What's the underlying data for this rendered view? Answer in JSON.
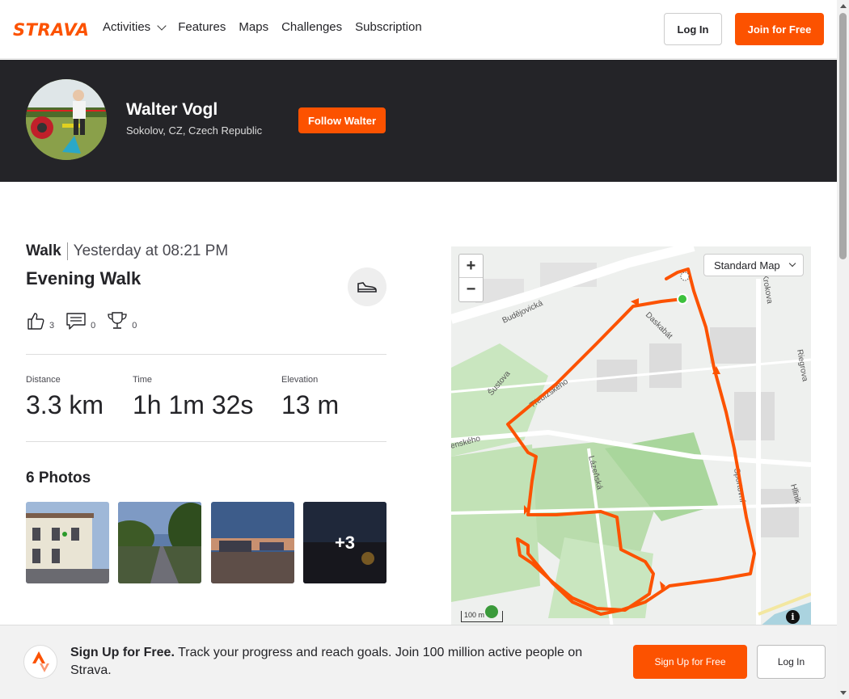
{
  "brand": {
    "name": "STRAVA",
    "accent": "#fc5200",
    "dark": "#242428"
  },
  "nav": {
    "items": [
      "Activities",
      "Features",
      "Maps",
      "Challenges",
      "Subscription"
    ],
    "login": "Log In",
    "join": "Join for Free"
  },
  "athlete": {
    "name": "Walter Vogl",
    "location": "Sokolov, CZ, Czech Republic",
    "follow": "Follow Walter"
  },
  "activity": {
    "type": "Walk",
    "date": "Yesterday at 08:21 PM",
    "title": "Evening Walk",
    "kudos": "3",
    "comments": "0",
    "achievements": "0",
    "stats": [
      {
        "label": "Distance",
        "value": "3.3 km"
      },
      {
        "label": "Time",
        "value": "1h 1m 32s"
      },
      {
        "label": "Elevation",
        "value": "13 m"
      }
    ],
    "photos_title": "6 Photos",
    "photos_more": "+3"
  },
  "map": {
    "style_select": "Standard Map",
    "zoom_in": "+",
    "zoom_out": "−",
    "scale": "100 m",
    "info": "i",
    "streets": [
      "Budějovická",
      "Daskabát",
      "Krokova",
      "Šustova",
      "Třebízského",
      "Riegrova",
      "enského",
      "Lázeňská",
      "Sportovní",
      "Hlinik"
    ]
  },
  "signup_bar": {
    "bold": "Sign Up for Free.",
    "text": " Track your progress and reach goals. Join 100 million active people on Strava.",
    "signup": "Sign Up for Free",
    "login": "Log In"
  }
}
